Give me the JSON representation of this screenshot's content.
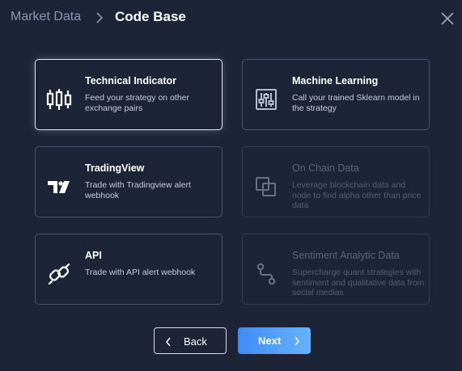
{
  "breadcrumb": {
    "previous": "Market Data",
    "current": "Code Base"
  },
  "cards": [
    {
      "title": "Technical Indicator",
      "desc": "Feed your strategy on other exchange pairs",
      "icon": "candlestick-icon",
      "state": "selected"
    },
    {
      "title": "Machine Learning",
      "desc": "Call your trained Sklearn model in the strategy",
      "icon": "sliders-icon",
      "state": "enabled"
    },
    {
      "title": "TradingView",
      "desc": "Trade with Tradingview alert webhook",
      "icon": "tradingview-logo-icon",
      "state": "enabled"
    },
    {
      "title": "On Chain Data",
      "desc": "Leverage blockchain data and node to find alpha other than price data",
      "icon": "overlapping-squares-icon",
      "state": "disabled"
    },
    {
      "title": "API",
      "desc": "Trade with API alert webhook",
      "icon": "link-icon",
      "state": "enabled"
    },
    {
      "title": "Sentiment Analytic Data",
      "desc": "Supercharge quant strategies with sentiment and qualitative data from social medias",
      "icon": "path-icon",
      "state": "disabled"
    }
  ],
  "buttons": {
    "back": "Back",
    "next": "Next"
  },
  "colors": {
    "background": "#1e2438",
    "accent_start": "#3f8cf5",
    "accent_end": "#66b2ff",
    "border": "#4a5270",
    "muted": "#8d96b3"
  }
}
